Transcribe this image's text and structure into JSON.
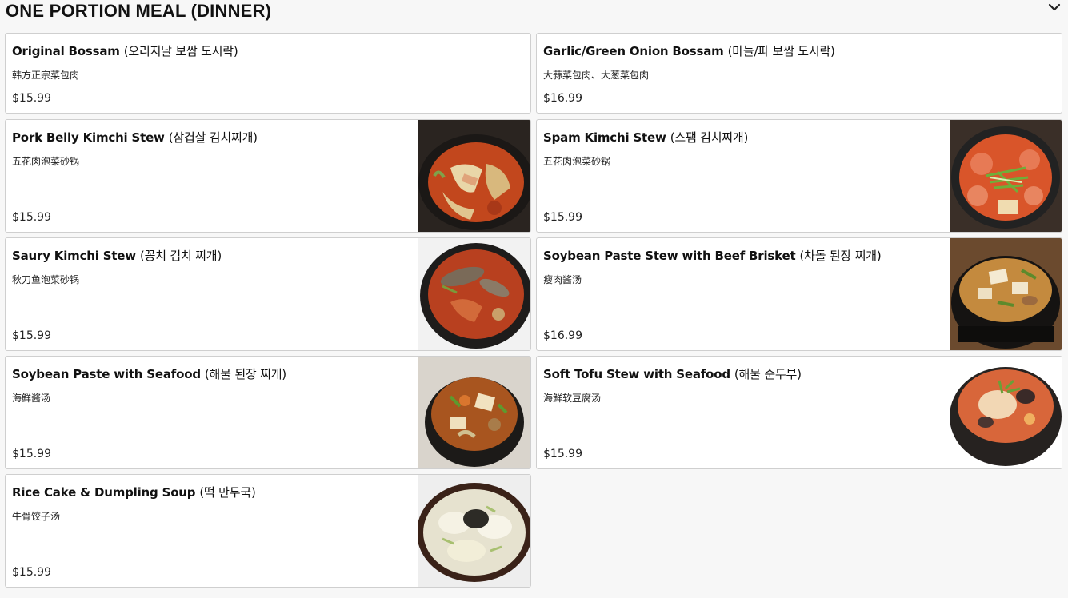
{
  "section": {
    "title": "ONE PORTION MEAL (DINNER)",
    "toggle_icon": "chevron-down-icon"
  },
  "items": [
    {
      "name": "Original Bossam",
      "name_kr": "(오리지날 보쌈 도시락)",
      "desc": "韩方正宗菜包肉",
      "price": "$15.99",
      "has_photo": false
    },
    {
      "name": "Garlic/Green Onion Bossam",
      "name_kr": "(마늘/파 보쌈 도시락)",
      "desc": "大蒜菜包肉、大葱菜包肉",
      "price": "$16.99",
      "has_photo": false
    },
    {
      "name": "Pork Belly Kimchi Stew",
      "name_kr": "(삼겹살 김치찌개)",
      "desc": "五花肉泡菜砂锅",
      "price": "$15.99",
      "has_photo": true,
      "photo": "kimchi-stew-photo"
    },
    {
      "name": "Spam Kimchi Stew",
      "name_kr": "(스팸 김치찌개)",
      "desc": "五花肉泡菜砂锅",
      "price": "$15.99",
      "has_photo": true,
      "photo": "spam-stew-photo"
    },
    {
      "name": "Saury Kimchi Stew",
      "name_kr": "(꽁치 김치 찌개)",
      "desc": "秋刀鱼泡菜砂锅",
      "price": "$15.99",
      "has_photo": true,
      "photo": "saury-stew-photo"
    },
    {
      "name": "Soybean Paste Stew with Beef Brisket",
      "name_kr": "(차돌 된장 찌개)",
      "desc": "瘦肉酱汤",
      "price": "$16.99",
      "has_photo": true,
      "photo": "soybean-brisket-photo"
    },
    {
      "name": "Soybean Paste with Seafood",
      "name_kr": "(해물 된장 찌개)",
      "desc": "海鲜酱汤",
      "price": "$15.99",
      "has_photo": true,
      "photo": "soybean-seafood-photo"
    },
    {
      "name": "Soft Tofu Stew with Seafood",
      "name_kr": "(해물 순두부)",
      "desc": "海鲜软豆腐汤",
      "price": "$15.99",
      "has_photo": true,
      "photo": "soft-tofu-photo"
    },
    {
      "name": "Rice Cake & Dumpling Soup",
      "name_kr": "(떡 만두국)",
      "desc": "牛骨饺子汤",
      "price": "$15.99",
      "has_photo": true,
      "photo": "dumpling-soup-photo"
    }
  ]
}
